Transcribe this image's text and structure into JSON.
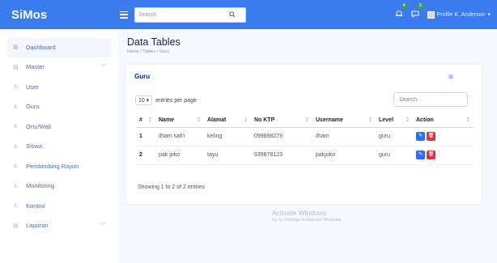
{
  "app": {
    "title": "SiMos"
  },
  "header": {
    "search_placeholder": "Search",
    "notif_badge": "4",
    "msg_badge": "3",
    "profile_name": "Profile K. Anderson"
  },
  "sidebar": {
    "items": [
      {
        "label": "Dashboard",
        "icon": "grid-icon",
        "active": true
      },
      {
        "label": "Master",
        "icon": "menu-icon",
        "chevron": true
      },
      {
        "label": "User",
        "icon": "person-icon"
      },
      {
        "label": "Guru",
        "icon": "person-icon"
      },
      {
        "label": "Ortu/Wali",
        "icon": "person-icon"
      },
      {
        "label": "Siswa",
        "icon": "person-icon"
      },
      {
        "label": "Pembimbing Rayon",
        "icon": "person-icon"
      },
      {
        "label": "Monitoring",
        "icon": "person-icon"
      },
      {
        "label": "Kontrol",
        "icon": "person-icon"
      },
      {
        "label": "Laporan",
        "icon": "menu-icon",
        "chevron": true
      }
    ]
  },
  "page": {
    "title": "Data Tables",
    "breadcrumb": "Home / Tables / Guru"
  },
  "card": {
    "title": "Guru",
    "entries_value": "10",
    "entries_label": "entries per page",
    "search_placeholder": "Search...",
    "columns": [
      "#",
      "Name",
      "Alamat",
      "No KTP",
      "Username",
      "Level",
      "Action"
    ],
    "rows": [
      {
        "no": "1",
        "name": "ilham safi'i",
        "alamat": "keling",
        "ktp": "099898279",
        "username": "ilham",
        "level": "guru"
      },
      {
        "no": "2",
        "name": "pak joko",
        "alamat": "tayu",
        "ktp": "939878123",
        "username": "pakjoko",
        "level": "guru"
      }
    ],
    "info": "Showing 1 to 2 of 2 entries"
  },
  "watermark": {
    "line1": "Activate Windows",
    "line2": "Go to Settings to activate Windows."
  },
  "colors": {
    "header": "#3a7bf0",
    "edit": "#2f6fed",
    "delete": "#dc3545"
  }
}
